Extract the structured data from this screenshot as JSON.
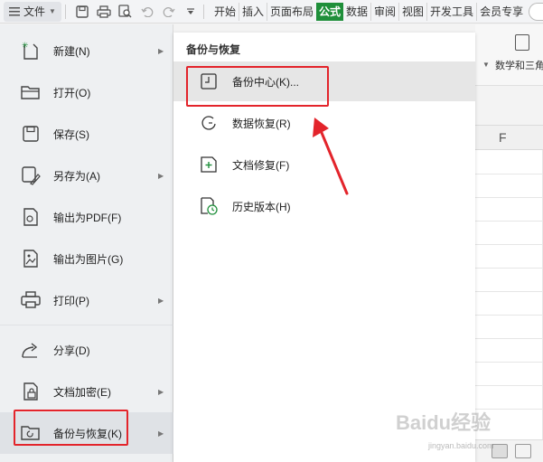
{
  "toolbar": {
    "file_label": "文件",
    "tabs": [
      {
        "label": "开始",
        "active": false
      },
      {
        "label": "插入",
        "active": false
      },
      {
        "label": "页面布局",
        "active": false
      },
      {
        "label": "公式",
        "active": true
      },
      {
        "label": "数据",
        "active": false
      },
      {
        "label": "审阅",
        "active": false
      },
      {
        "label": "视图",
        "active": false
      },
      {
        "label": "开发工具",
        "active": false
      },
      {
        "label": "会员专享",
        "active": false
      }
    ],
    "icons": [
      "menu-icon",
      "save-icon",
      "print-icon",
      "print-preview-icon",
      "undo-icon",
      "redo-icon",
      "customize-arrow-icon"
    ],
    "accent_color": "#1f8f3a"
  },
  "ribbon": {
    "math_label": "数学和三角",
    "column_header": "F"
  },
  "file_menu": {
    "items": [
      {
        "label": "新建(N)",
        "icon": "new-file-icon",
        "has_submenu": true
      },
      {
        "label": "打开(O)",
        "icon": "open-folder-icon",
        "has_submenu": false
      },
      {
        "label": "保存(S)",
        "icon": "save-icon",
        "has_submenu": false
      },
      {
        "label": "另存为(A)",
        "icon": "save-as-icon",
        "has_submenu": true
      },
      {
        "label": "输出为PDF(F)",
        "icon": "export-pdf-icon",
        "has_submenu": false
      },
      {
        "label": "输出为图片(G)",
        "icon": "export-image-icon",
        "has_submenu": false
      },
      {
        "label": "打印(P)",
        "icon": "print-icon",
        "has_submenu": true
      },
      {
        "label": "分享(D)",
        "icon": "share-icon",
        "has_submenu": false
      },
      {
        "label": "文档加密(E)",
        "icon": "encrypt-icon",
        "has_submenu": true
      },
      {
        "label": "备份与恢复(K)",
        "icon": "backup-restore-icon",
        "has_submenu": true,
        "selected": true
      }
    ]
  },
  "submenu": {
    "title": "备份与恢复",
    "items": [
      {
        "label": "备份中心(K)...",
        "icon": "backup-center-icon",
        "hover": true
      },
      {
        "label": "数据恢复(R)",
        "icon": "data-recovery-icon"
      },
      {
        "label": "文档修复(F)",
        "icon": "document-repair-icon"
      },
      {
        "label": "历史版本(H)",
        "icon": "history-version-icon"
      }
    ]
  },
  "annotation": {
    "highlight_color": "#e3242b"
  },
  "watermark": {
    "text": "Baidu经验",
    "sub": "jingyan.baidu.com"
  }
}
